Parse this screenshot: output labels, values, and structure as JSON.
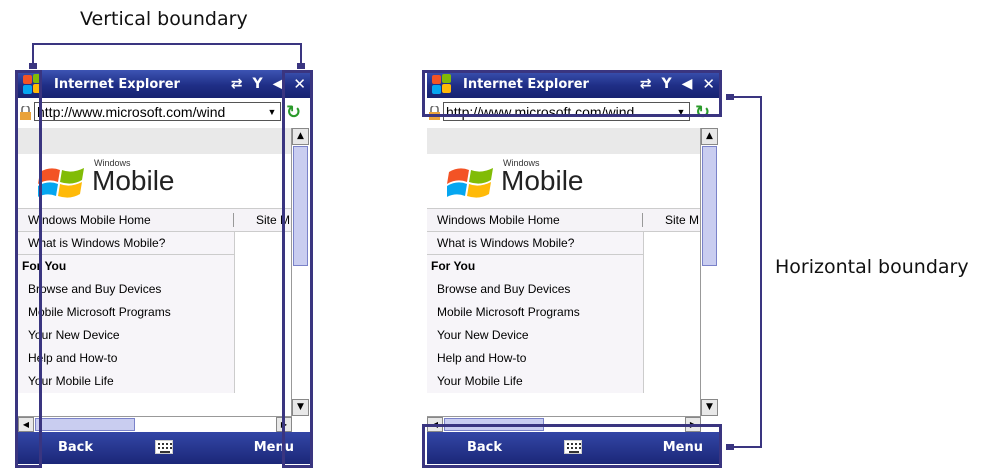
{
  "callouts": {
    "vertical_label": "Vertical boundary",
    "horizontal_label": "Horizontal boundary"
  },
  "browser": {
    "title": "Internet Explorer",
    "address": "http://www.microsoft.com/wind",
    "brand_small": "Windows",
    "brand_large": "Mobile",
    "nav_home": "Windows Mobile Home",
    "nav_site": "Site M",
    "what_is": "What is Windows Mobile?",
    "section_header": "For You",
    "links": [
      "Browse and Buy Devices",
      "Mobile Microsoft Programs",
      "Your New Device",
      "Help and How-to",
      "Your Mobile Life"
    ],
    "softkey_left": "Back",
    "softkey_right": "Menu"
  },
  "icons": {
    "title_icons": [
      "windows-flag-icon",
      "connectivity-icon",
      "signal-icon",
      "volume-icon",
      "close-icon"
    ],
    "keyboard": "keyboard-icon"
  },
  "colors": {
    "accent": "#3a3580",
    "titlebar": "#1f2e86",
    "softbar": "#1b2778"
  }
}
